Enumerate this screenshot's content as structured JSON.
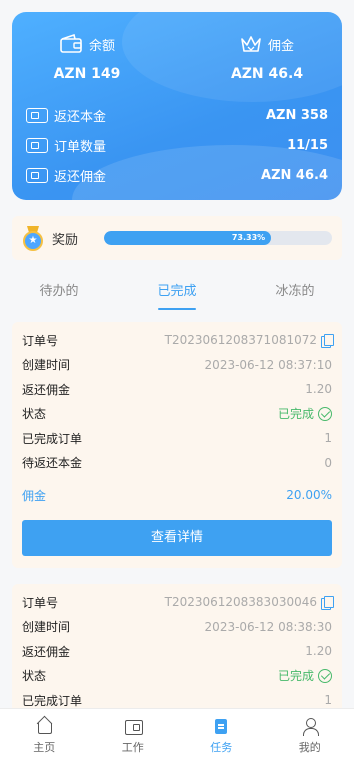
{
  "hero": {
    "balance_label": "余额",
    "balance_value": "AZN 149",
    "commission_label": "佣金",
    "commission_value": "AZN 46.4",
    "rows": [
      {
        "label": "返还本金",
        "value": "AZN 358"
      },
      {
        "label": "订单数量",
        "value": "11/15"
      },
      {
        "label": "返还佣金",
        "value": "AZN 46.4"
      }
    ]
  },
  "reward": {
    "label": "奖励",
    "progress_text": "73.33%",
    "progress_fraction": 0.7333
  },
  "tabs": [
    {
      "label": "待办的",
      "active": false
    },
    {
      "label": "已完成",
      "active": true
    },
    {
      "label": "冰冻的",
      "active": false
    }
  ],
  "orders": [
    {
      "order_no_label": "订单号",
      "order_no": "T2023061208371081072",
      "created_label": "创建时间",
      "created": "2023-06-12 08:37:10",
      "commission_label": "返还佣金",
      "commission": "1.20",
      "status_label": "状态",
      "status": "已完成",
      "done_label": "已完成订单",
      "done": "1",
      "pending_label": "待返还本金",
      "pending": "0",
      "rate_label": "佣金",
      "rate": "20.00%",
      "button": "查看详情"
    },
    {
      "order_no_label": "订单号",
      "order_no": "T2023061208383030046",
      "created_label": "创建时间",
      "created": "2023-06-12 08:38:30",
      "commission_label": "返还佣金",
      "commission": "1.20",
      "status_label": "状态",
      "status": "已完成",
      "done_label": "已完成订单",
      "done": "1"
    }
  ],
  "nav": [
    {
      "label": "主页",
      "icon": "home-icon"
    },
    {
      "label": "工作",
      "icon": "wallet-icon"
    },
    {
      "label": "任务",
      "icon": "clipboard-icon"
    },
    {
      "label": "我的",
      "icon": "user-icon"
    }
  ],
  "colors": {
    "accent": "#3ea1f2",
    "success": "#48b96b",
    "card_bg": "#fdf6ee"
  }
}
